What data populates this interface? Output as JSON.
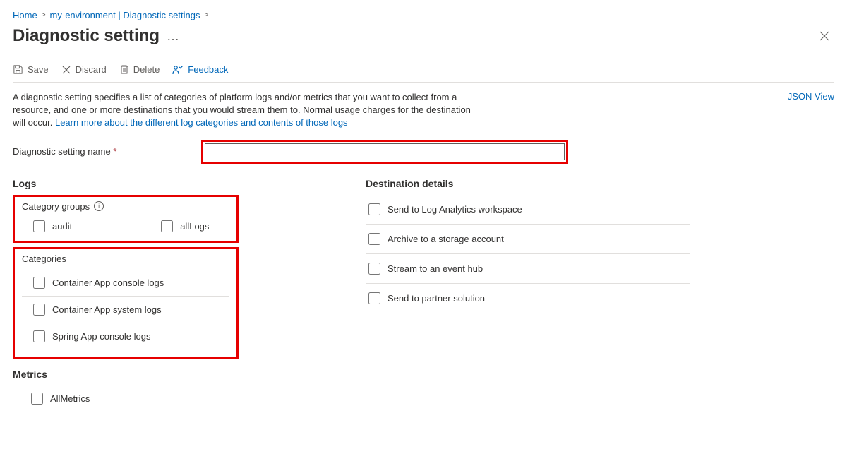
{
  "breadcrumb": {
    "home": "Home",
    "env": "my-environment | Diagnostic settings"
  },
  "page_title": "Diagnostic setting",
  "toolbar": {
    "save": "Save",
    "discard": "Discard",
    "delete": "Delete",
    "feedback": "Feedback"
  },
  "description_a": "A diagnostic setting specifies a list of categories of platform logs and/or metrics that you want to collect from a resource, and one or more destinations that you would stream them to. Normal usage charges for the destination will occur. ",
  "learn_link": "Learn more about the different log categories and contents of those logs",
  "json_view": "JSON View",
  "name_label": "Diagnostic setting name",
  "logs_h": "Logs",
  "cat_groups_h": "Category groups",
  "cg": {
    "audit": "audit",
    "allLogs": "allLogs"
  },
  "categories_h": "Categories",
  "cats": {
    "c1": "Container App console logs",
    "c2": "Container App system logs",
    "c3": "Spring App console logs"
  },
  "metrics_h": "Metrics",
  "metrics_item": "AllMetrics",
  "dest_h": "Destination details",
  "dest": {
    "d1": "Send to Log Analytics workspace",
    "d2": "Archive to a storage account",
    "d3": "Stream to an event hub",
    "d4": "Send to partner solution"
  }
}
